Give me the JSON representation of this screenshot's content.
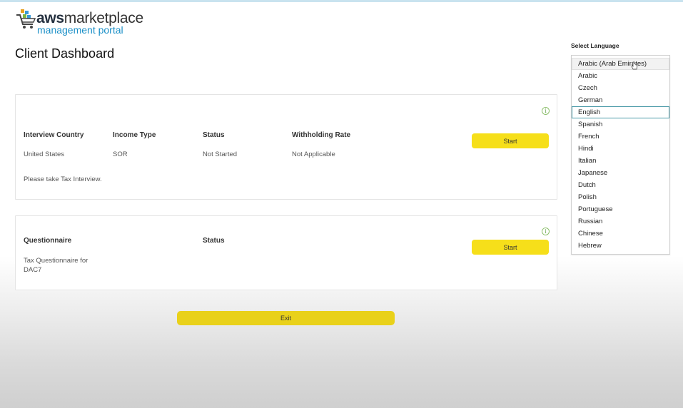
{
  "logo": {
    "brand_bold": "aws",
    "brand_rest": "marketplace",
    "subtitle": "management portal"
  },
  "page": {
    "title": "Client Dashboard"
  },
  "tax_interview": {
    "headers": [
      "Interview Country",
      "Income Type",
      "Status",
      "Withholding Rate"
    ],
    "row": [
      "United States",
      "SOR",
      "Not Started",
      "Not Applicable"
    ],
    "note": "Please take Tax Interview.",
    "button_label": "Start"
  },
  "questionnaire": {
    "headers": [
      "Questionnaire",
      "Status"
    ],
    "name": "Tax Questionnaire for DAC7",
    "status": "",
    "button_label": "Start"
  },
  "exit_label": "Exit",
  "language": {
    "label": "Select Language",
    "hovered": "Arabic (Arab Emirates)",
    "selected": "English",
    "options": [
      "Arabic (Arab Emirates)",
      "Arabic",
      "Czech",
      "German",
      "English",
      "Spanish",
      "French",
      "Hindi",
      "Italian",
      "Japanese",
      "Dutch",
      "Polish",
      "Portuguese",
      "Russian",
      "Chinese",
      "Hebrew"
    ]
  },
  "colors": {
    "button_yellow": "#f6df1a",
    "info_green": "#6aa84f",
    "selected_border": "#4a9aa8",
    "logo_blue": "#1a8fc7"
  }
}
